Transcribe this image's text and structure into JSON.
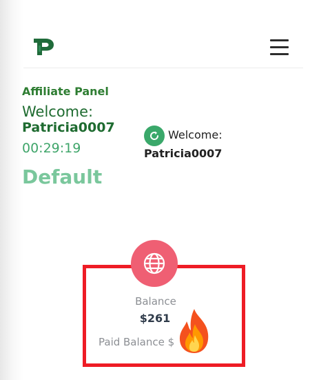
{
  "header": {
    "logo_icon": "rp-logo-icon",
    "menu_icon": "hamburger-menu-icon"
  },
  "sidebar_panel": {
    "title": "Affiliate Panel",
    "welcome": "Welcome:",
    "username": "Patricia0007",
    "timer": "00:29:19",
    "status": "Default"
  },
  "user_card": {
    "icon": "refresh-icon",
    "welcome": "Welcome:",
    "username": "Patricia0007"
  },
  "balance_card": {
    "icon": "globe-icon",
    "balance_label": "Balance",
    "balance_value": "$261",
    "paid_balance_label": "Paid Balance $"
  },
  "annotation": {
    "emoji": "fire-emoji",
    "highlight_color": "#ee1c25"
  },
  "colors": {
    "brand_green": "#1e6b30",
    "accent_green": "#3aa86a",
    "globe_badge": "#ef5f73"
  }
}
